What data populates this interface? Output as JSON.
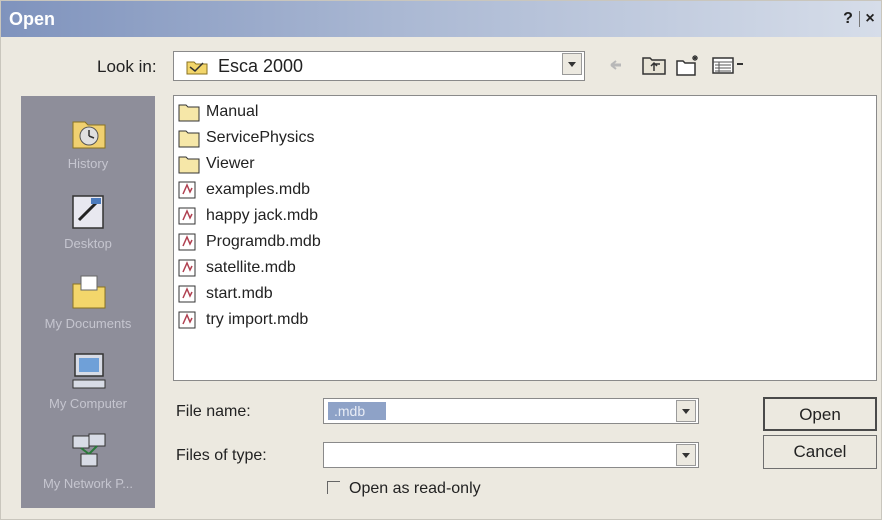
{
  "window": {
    "title": "Open",
    "help_label": "?",
    "close_label": "×"
  },
  "look_in": {
    "label": "Look in:",
    "value": "Esca 2000"
  },
  "places": [
    {
      "label": "History",
      "icon": "history-icon"
    },
    {
      "label": "Desktop",
      "icon": "desktop-icon"
    },
    {
      "label": "My Documents",
      "icon": "my-documents-icon"
    },
    {
      "label": "My Computer",
      "icon": "my-computer-icon"
    },
    {
      "label": "My Network P...",
      "icon": "my-network-places-icon"
    }
  ],
  "files": [
    {
      "name": "Manual",
      "type": "folder"
    },
    {
      "name": "ServicePhysics",
      "type": "folder"
    },
    {
      "name": "Viewer",
      "type": "folder"
    },
    {
      "name": "examples.mdb",
      "type": "mdb"
    },
    {
      "name": "happy jack.mdb",
      "type": "mdb"
    },
    {
      "name": "Programdb.mdb",
      "type": "mdb"
    },
    {
      "name": "satellite.mdb",
      "type": "mdb"
    },
    {
      "name": "start.mdb",
      "type": "mdb"
    },
    {
      "name": "try import.mdb",
      "type": "mdb"
    }
  ],
  "file_name": {
    "label": "File name:",
    "value": ".mdb"
  },
  "files_of_type": {
    "label": "Files of type:",
    "value": ""
  },
  "buttons": {
    "open": "Open",
    "cancel": "Cancel"
  },
  "read_only": {
    "label": "Open as read-only",
    "checked": false
  }
}
